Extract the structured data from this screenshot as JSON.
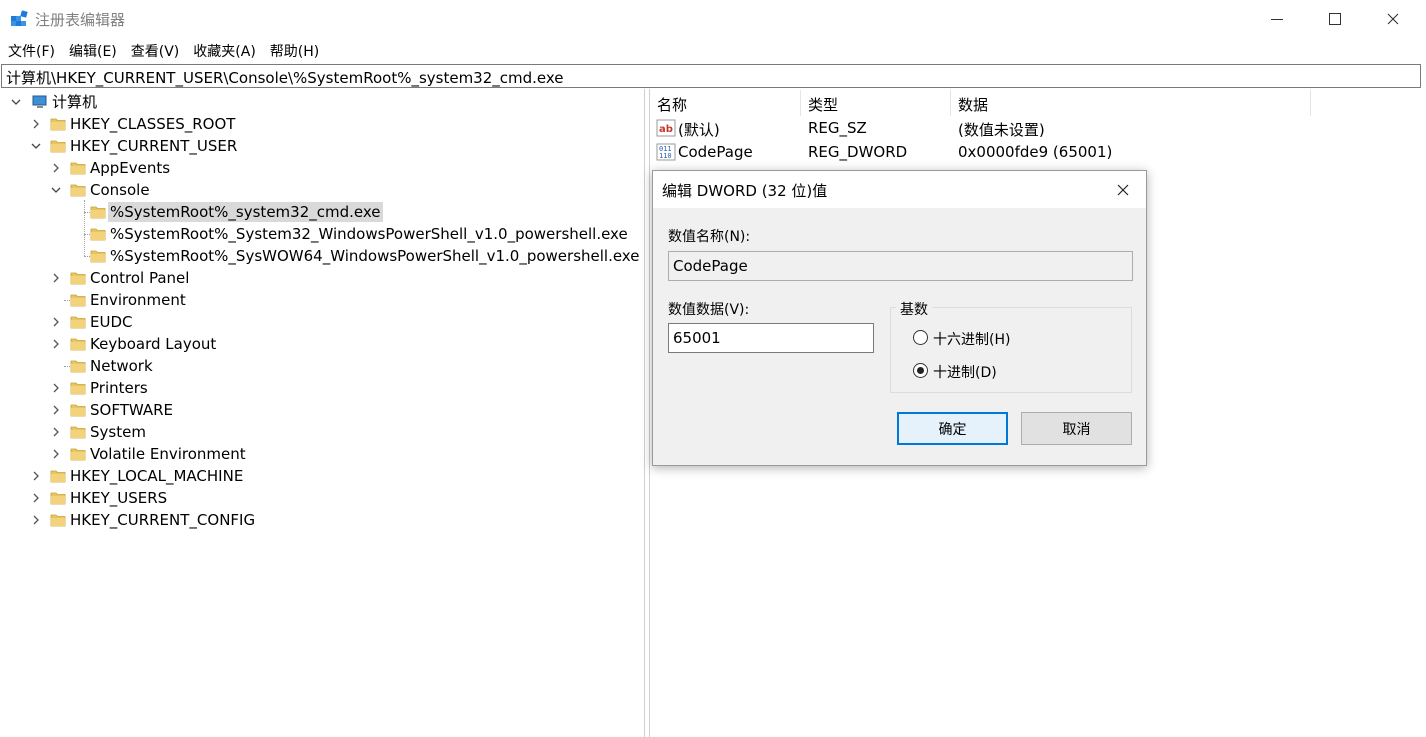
{
  "window": {
    "title": "注册表编辑器",
    "controls": {
      "minimize": "—",
      "maximize": "☐",
      "close": "✕"
    }
  },
  "menu": [
    "文件(F)",
    "编辑(E)",
    "查看(V)",
    "收藏夹(A)",
    "帮助(H)"
  ],
  "address": "计算机\\HKEY_CURRENT_USER\\Console\\%SystemRoot%_system32_cmd.exe",
  "tree": {
    "root": "计算机",
    "items": [
      {
        "label": "HKEY_CLASSES_ROOT"
      },
      {
        "label": "HKEY_CURRENT_USER"
      },
      {
        "label": "AppEvents"
      },
      {
        "label": "Console"
      },
      {
        "label": "%SystemRoot%_system32_cmd.exe",
        "selected": true
      },
      {
        "label": "%SystemRoot%_System32_WindowsPowerShell_v1.0_powershell.exe"
      },
      {
        "label": "%SystemRoot%_SysWOW64_WindowsPowerShell_v1.0_powershell.exe"
      },
      {
        "label": "Control Panel"
      },
      {
        "label": "Environment"
      },
      {
        "label": "EUDC"
      },
      {
        "label": "Keyboard Layout"
      },
      {
        "label": "Network"
      },
      {
        "label": "Printers"
      },
      {
        "label": "SOFTWARE"
      },
      {
        "label": "System"
      },
      {
        "label": "Volatile Environment"
      },
      {
        "label": "HKEY_LOCAL_MACHINE"
      },
      {
        "label": "HKEY_USERS"
      },
      {
        "label": "HKEY_CURRENT_CONFIG"
      }
    ]
  },
  "list": {
    "columns": [
      "名称",
      "类型",
      "数据"
    ],
    "rows": [
      {
        "icon": "string-value-icon",
        "name": "(默认)",
        "type": "REG_SZ",
        "data": "(数值未设置)"
      },
      {
        "icon": "binary-value-icon",
        "name": "CodePage",
        "type": "REG_DWORD",
        "data": "0x0000fde9 (65001)"
      }
    ]
  },
  "dialog": {
    "title": "编辑 DWORD (32 位)值",
    "name_label": "数值名称(N):",
    "name_value": "CodePage",
    "data_label": "数值数据(V):",
    "data_value": "65001",
    "base_label": "基数",
    "radio_hex": "十六进制(H)",
    "radio_dec": "十进制(D)",
    "selected_base": "decimal",
    "ok": "确定",
    "cancel": "取消"
  },
  "colors": {
    "selection": "#d9d9d9",
    "folder": "#e8c462",
    "dialog_bg": "#f0f0f0",
    "default_button_border": "#0078d7"
  }
}
